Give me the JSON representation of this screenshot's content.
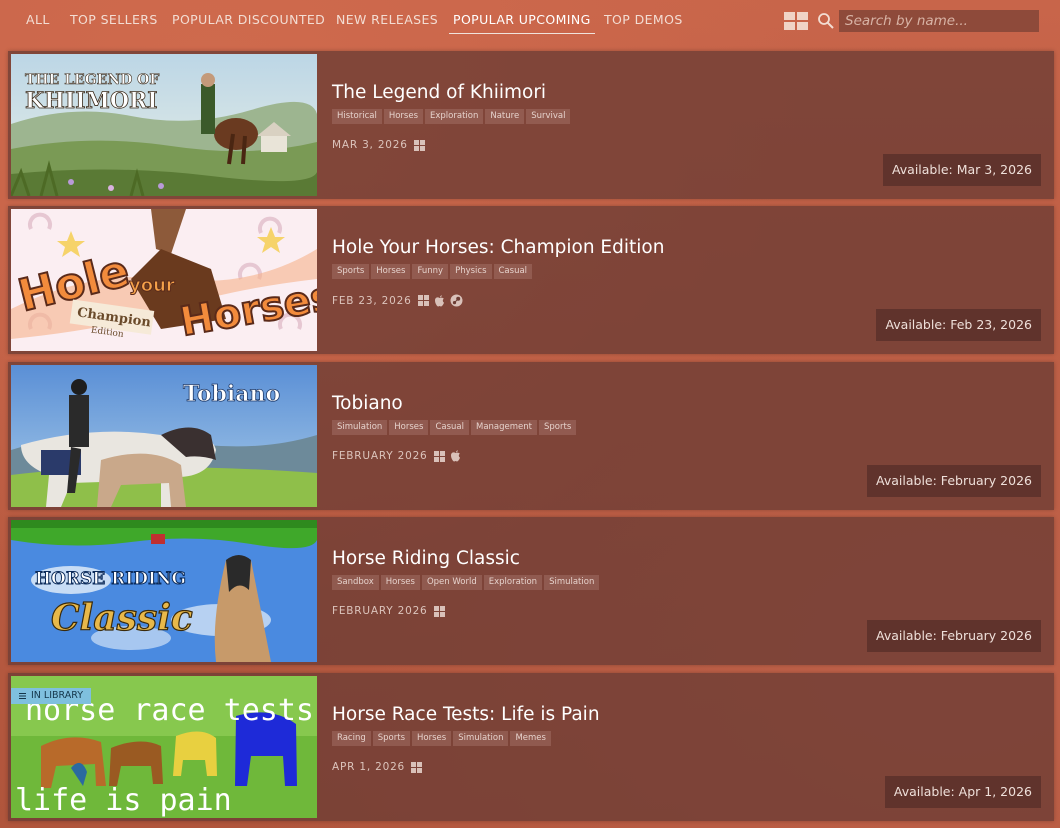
{
  "nav": {
    "tabs": [
      {
        "label": "ALL",
        "active": false
      },
      {
        "label": "TOP SELLERS",
        "active": false
      },
      {
        "label": "POPULAR DISCOUNTED",
        "active": false
      },
      {
        "label": "NEW RELEASES",
        "active": false
      },
      {
        "label": "POPULAR UPCOMING",
        "active": true
      },
      {
        "label": "TOP DEMOS",
        "active": false
      }
    ],
    "view_icon": "grid-view-icon",
    "search_icon": "search-icon",
    "search_placeholder": "Search by name..."
  },
  "games": [
    {
      "title": "The Legend of Khiimori",
      "thumb_text": "THE LEGEND OF KHIIMORI",
      "tags": [
        "Historical",
        "Horses",
        "Exploration",
        "Nature",
        "Survival"
      ],
      "date": "MAR 3, 2026",
      "platforms": [
        "windows"
      ],
      "availability": "Available: Mar 3, 2026",
      "in_library": false
    },
    {
      "title": "Hole Your Horses: Champion Edition",
      "thumb_text": "Hole your Horses",
      "thumb_subtext": "Champion Edition",
      "tags": [
        "Sports",
        "Horses",
        "Funny",
        "Physics",
        "Casual"
      ],
      "date": "FEB 23, 2026",
      "platforms": [
        "windows",
        "mac",
        "steam"
      ],
      "availability": "Available: Feb 23, 2026",
      "in_library": false
    },
    {
      "title": "Tobiano",
      "thumb_text": "Tobiano",
      "tags": [
        "Simulation",
        "Horses",
        "Casual",
        "Management",
        "Sports"
      ],
      "date": "FEBRUARY 2026",
      "platforms": [
        "windows",
        "mac"
      ],
      "availability": "Available: February 2026",
      "in_library": false
    },
    {
      "title": "Horse Riding Classic",
      "thumb_text": "HORSE RIDING",
      "thumb_subtext": "Classic",
      "tags": [
        "Sandbox",
        "Horses",
        "Open World",
        "Exploration",
        "Simulation"
      ],
      "date": "FEBRUARY 2026",
      "platforms": [
        "windows"
      ],
      "availability": "Available: February 2026",
      "in_library": false
    },
    {
      "title": "Horse Race Tests: Life is Pain",
      "thumb_text": "horse race tests",
      "thumb_subtext": "life is pain",
      "tags": [
        "Racing",
        "Sports",
        "Horses",
        "Simulation",
        "Memes"
      ],
      "date": "APR 1, 2026",
      "platforms": [
        "windows"
      ],
      "availability": "Available: Apr 1, 2026",
      "in_library": true,
      "library_badge": "IN LIBRARY"
    }
  ],
  "colors": {
    "background": "#b85a3f",
    "card": "#6c3c34",
    "library_badge": "#7fc0de"
  }
}
